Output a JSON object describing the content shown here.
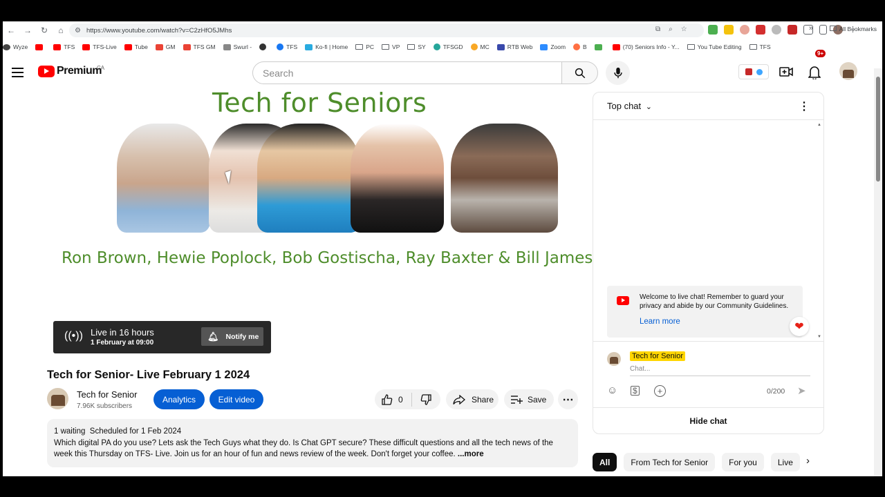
{
  "browser": {
    "url": "https://www.youtube.com/watch?v=C2zHfO5JMhs",
    "bookmarks": [
      "Wyze",
      "",
      "TFS",
      "TFS-Live",
      "Tube",
      "GM",
      "TFS GM",
      "Swurl -",
      "",
      "TFS",
      "Ko-fi | Home",
      "PC",
      "VP",
      "SY",
      "TFSGD",
      "MC",
      "RTB Web",
      "Zoom",
      "B",
      "",
      "(70) Seniors Info - Y...",
      "You Tube Editing",
      "TFS"
    ],
    "all_bookmarks": "All Bookmarks"
  },
  "header": {
    "logo": "Premium",
    "country": "CA",
    "search_placeholder": "Search",
    "notif_count": "9+"
  },
  "thumbnail": {
    "title": "Tech for Seniors",
    "names": "Ron Brown, Hewie Poplock, Bob  Gostischa, Ray Baxter & Bill James"
  },
  "live": {
    "status": "Live in 16 hours",
    "time": "1 February at 09:00",
    "notify": "Notify me"
  },
  "video": {
    "title": "Tech for Senior- Live February 1 2024",
    "channel": "Tech for Senior",
    "subscribers": "7.96K subscribers",
    "analytics": "Analytics",
    "edit": "Edit video",
    "likes": "0",
    "share": "Share",
    "save": "Save"
  },
  "description": {
    "waiting": "1 waiting",
    "scheduled": "Scheduled for 1 Feb 2024",
    "text": "Which digital PA do you use?  Lets ask the Tech Guys what they do.  Is Chat GPT secure?  These difficult questions and all the tech news of the week this Thursday on TFS- Live.  Join us for an  hour of fun and news review of the week. Don't forget your coffee.",
    "more": "...more"
  },
  "chat": {
    "mode": "Top chat",
    "welcome": "Welcome to live chat! Remember to guard your privacy and abide by our Community Guidelines.",
    "learn_more": "Learn more",
    "user": "Tech for Senior",
    "placeholder": "Chat...",
    "counter": "0/200",
    "hide": "Hide chat"
  },
  "chips": [
    "All",
    "From Tech for Senior",
    "For you",
    "Live"
  ]
}
